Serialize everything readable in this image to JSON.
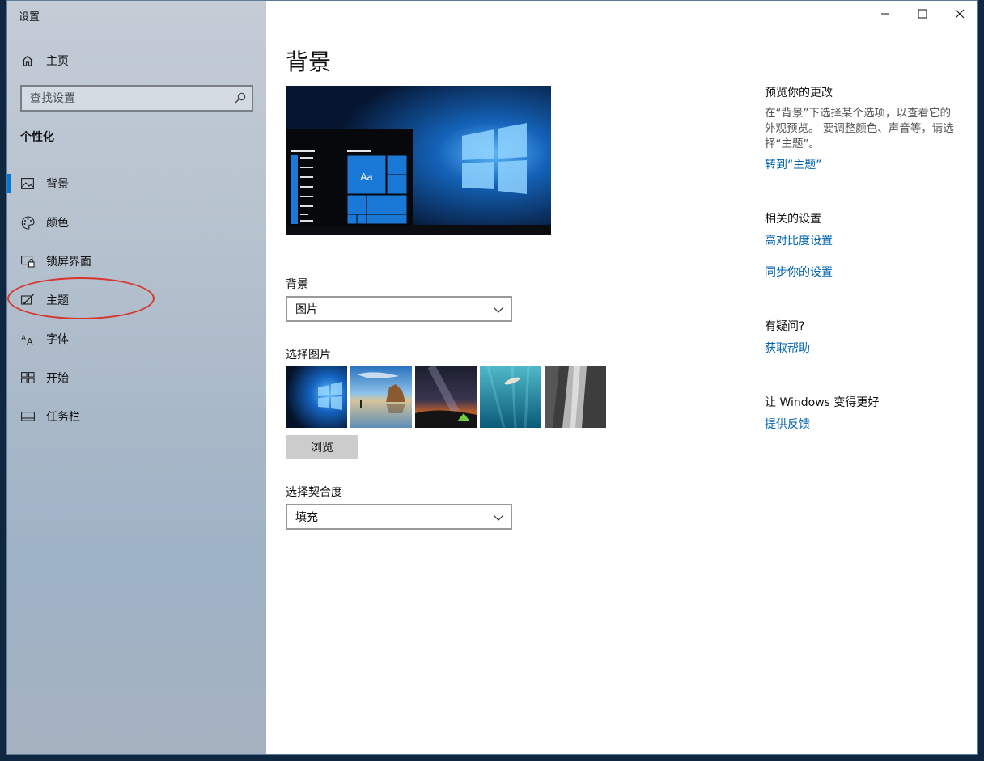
{
  "window": {
    "title": "设置",
    "controls": {
      "minimize": "—",
      "maximize": "☐",
      "close": "✕"
    }
  },
  "sidebar": {
    "home_label": "主页",
    "search_placeholder": "查找设置",
    "section_title": "个性化",
    "items": [
      {
        "label": "背景",
        "icon": "picture-icon",
        "active": true
      },
      {
        "label": "颜色",
        "icon": "palette-icon",
        "active": false
      },
      {
        "label": "锁屏界面",
        "icon": "lock-screen-icon",
        "active": false
      },
      {
        "label": "主题",
        "icon": "theme-brush-icon",
        "active": false
      },
      {
        "label": "字体",
        "icon": "font-icon",
        "active": false
      },
      {
        "label": "开始",
        "icon": "start-tiles-icon",
        "active": false
      },
      {
        "label": "任务栏",
        "icon": "taskbar-icon",
        "active": false
      }
    ],
    "annotation_color": "#d6372f"
  },
  "main": {
    "title": "背景",
    "preview_tile_label": "Aa",
    "background_label": "背景",
    "background_value": "图片",
    "choose_picture_label": "选择图片",
    "thumbnails": [
      "windows-hero",
      "beach-rock",
      "night-sky-tent",
      "underwater-swimmer",
      "rock-cliff"
    ],
    "browse_label": "浏览",
    "fit_label": "选择契合度",
    "fit_value": "填充"
  },
  "right": {
    "preview_title": "预览你的更改",
    "preview_desc": "在“背景”下选择某个选项，以查看它的外观预览。 要调整颜色、声音等，请选择“主题”。",
    "goto_theme_link": "转到“主题”",
    "related_title": "相关的设置",
    "high_contrast_link": "高对比度设置",
    "sync_link": "同步你的设置",
    "question_title": "有疑问?",
    "help_link": "获取帮助",
    "feedback_title": "让 Windows 变得更好",
    "feedback_link": "提供反馈"
  },
  "colors": {
    "accent": "#0078d7",
    "link": "#0063b1"
  }
}
